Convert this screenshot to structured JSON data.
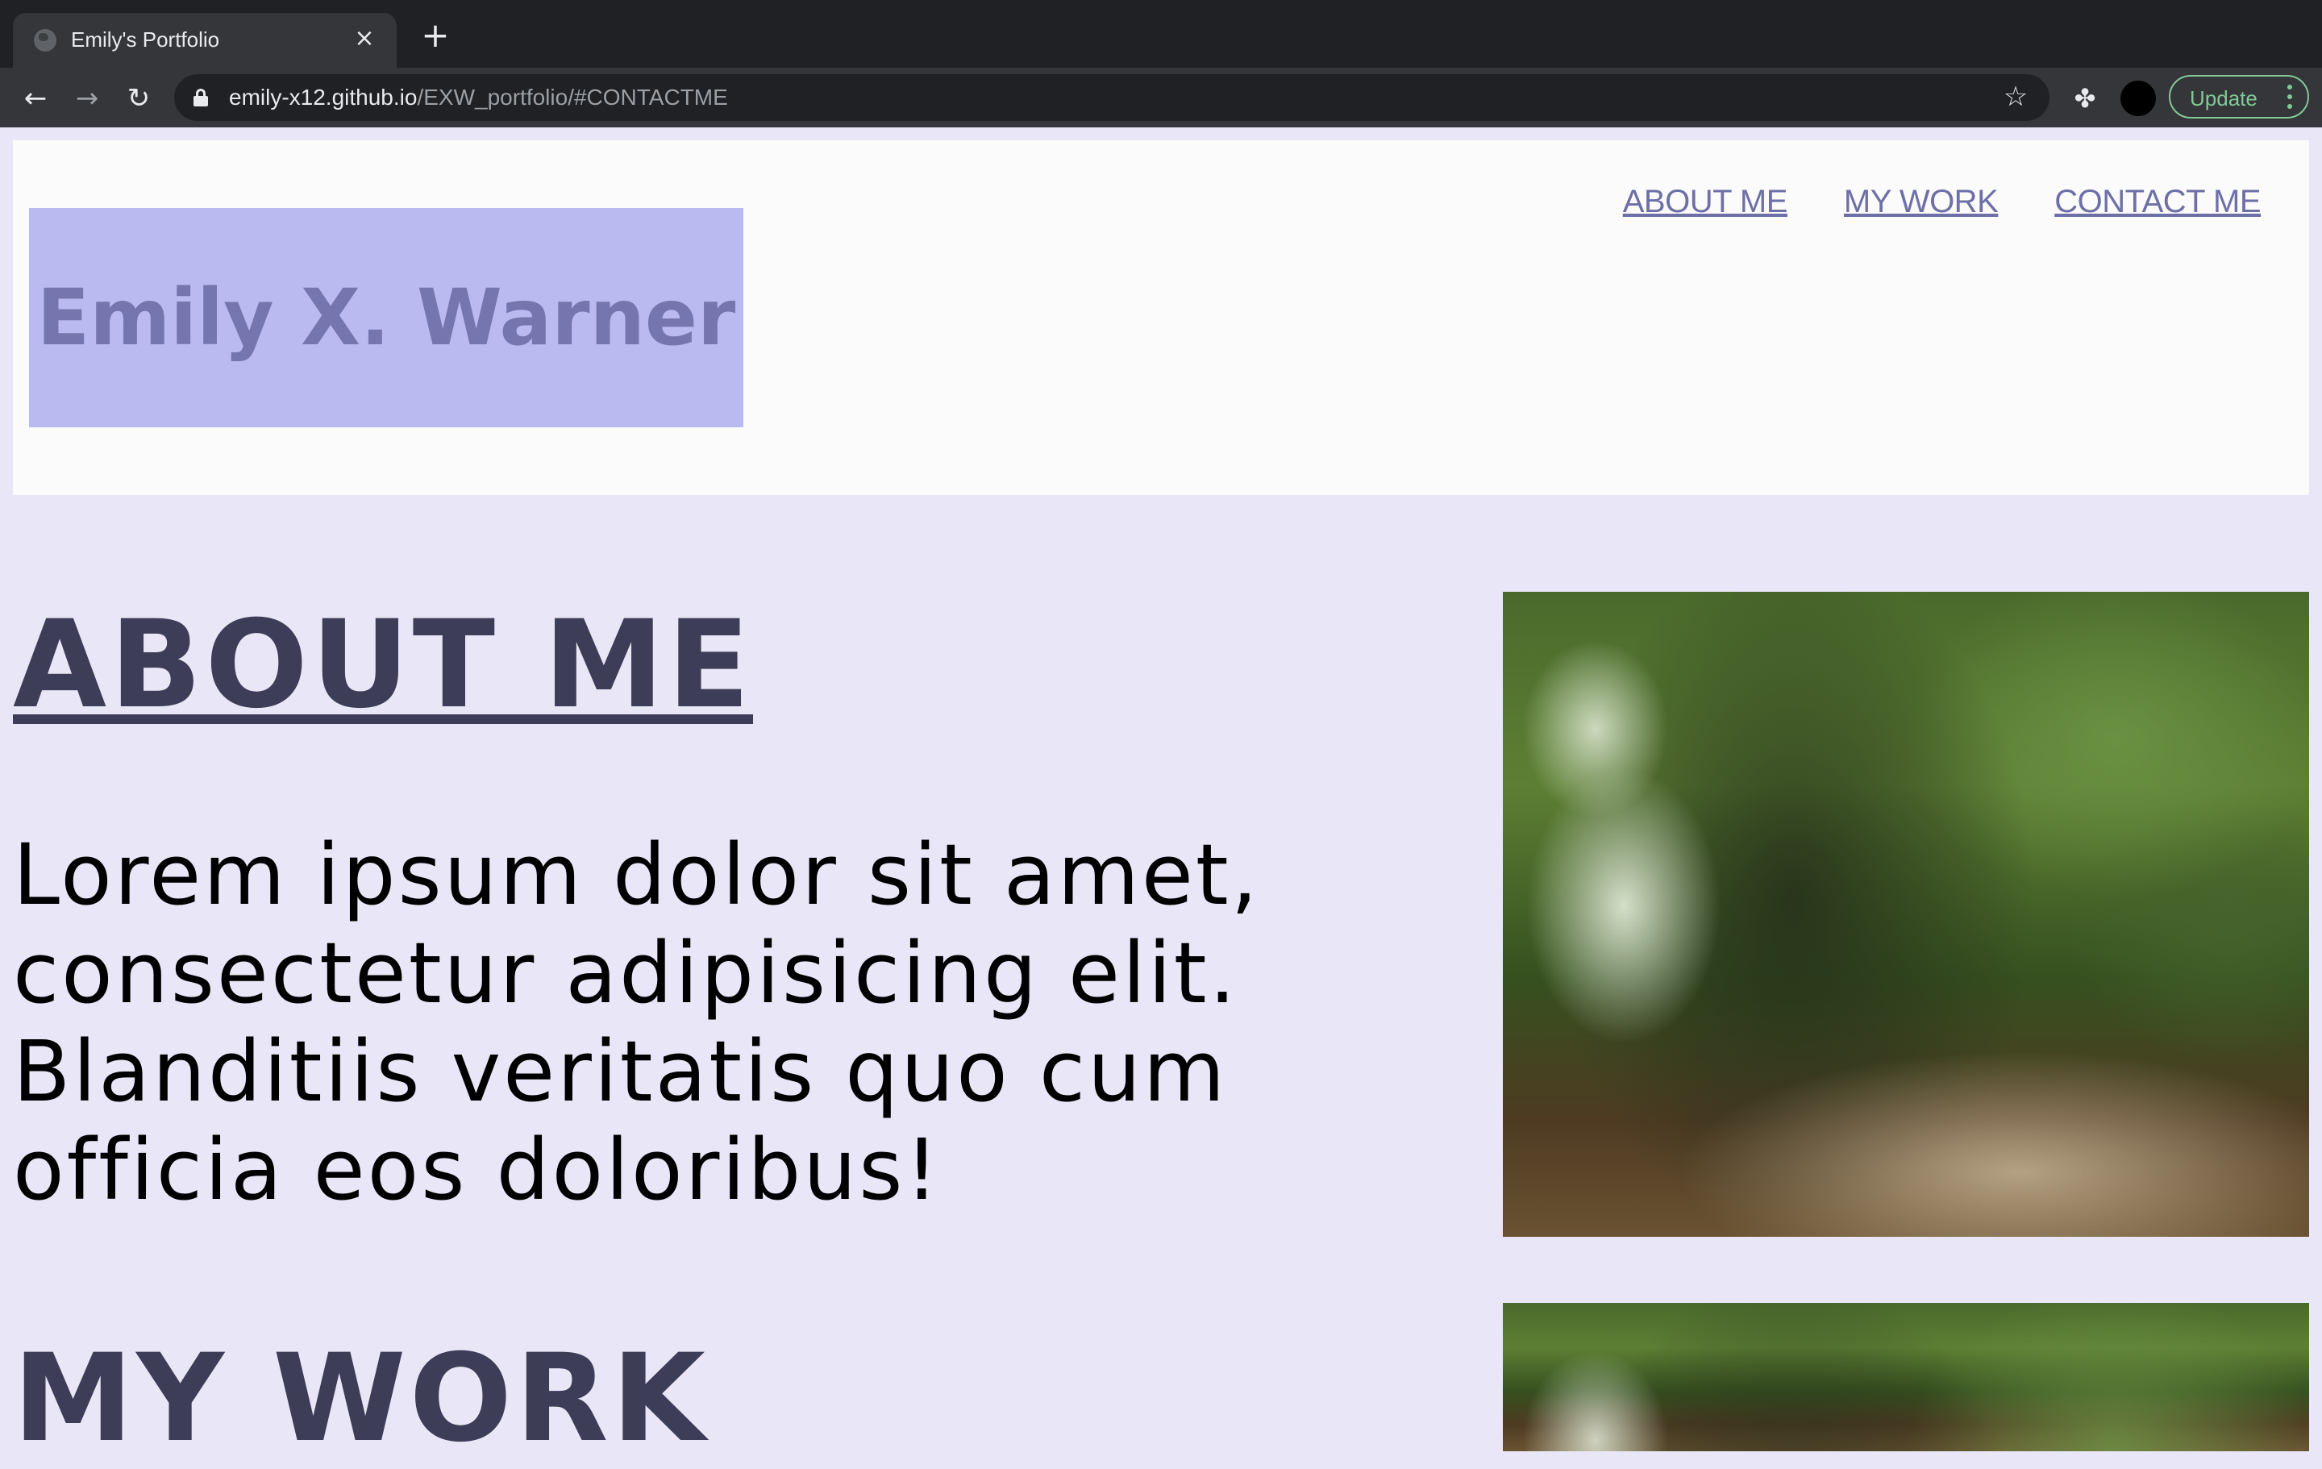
{
  "browser": {
    "tab_title": "Emily's Portfolio",
    "url_host": "emily-x12.github.io",
    "url_path": "/EXW_portfolio/#CONTACTME",
    "update_label": "Update"
  },
  "header": {
    "logo_text": "Emily X. Warner",
    "nav": [
      {
        "label": "ABOUT ME"
      },
      {
        "label": "MY WORK"
      },
      {
        "label": "CONTACT ME"
      }
    ]
  },
  "about": {
    "heading": "ABOUT ME",
    "text": "Lorem ipsum dolor sit amet, consectetur adipisicing elit. Blanditiis veritatis quo cum officia eos doloribus!"
  },
  "work": {
    "heading": "MY WORK"
  },
  "colors": {
    "page_background": "#e9e6f7",
    "header_background": "#fbfbfb",
    "logo_background": "#babaf0",
    "logo_text": "#7676ae",
    "nav_link": "#6f6fa8",
    "heading": "#3d3d57",
    "update_accent": "#81c995"
  },
  "icons": {
    "tab_favicon": "globe-icon",
    "tab_close": "close-icon",
    "new_tab": "plus-icon",
    "back": "arrow-left-icon",
    "forward": "arrow-right-icon",
    "reload": "reload-icon",
    "lock": "lock-icon",
    "bookmark": "star-icon",
    "extensions": "puzzle-icon",
    "menu": "kebab-menu-icon"
  }
}
